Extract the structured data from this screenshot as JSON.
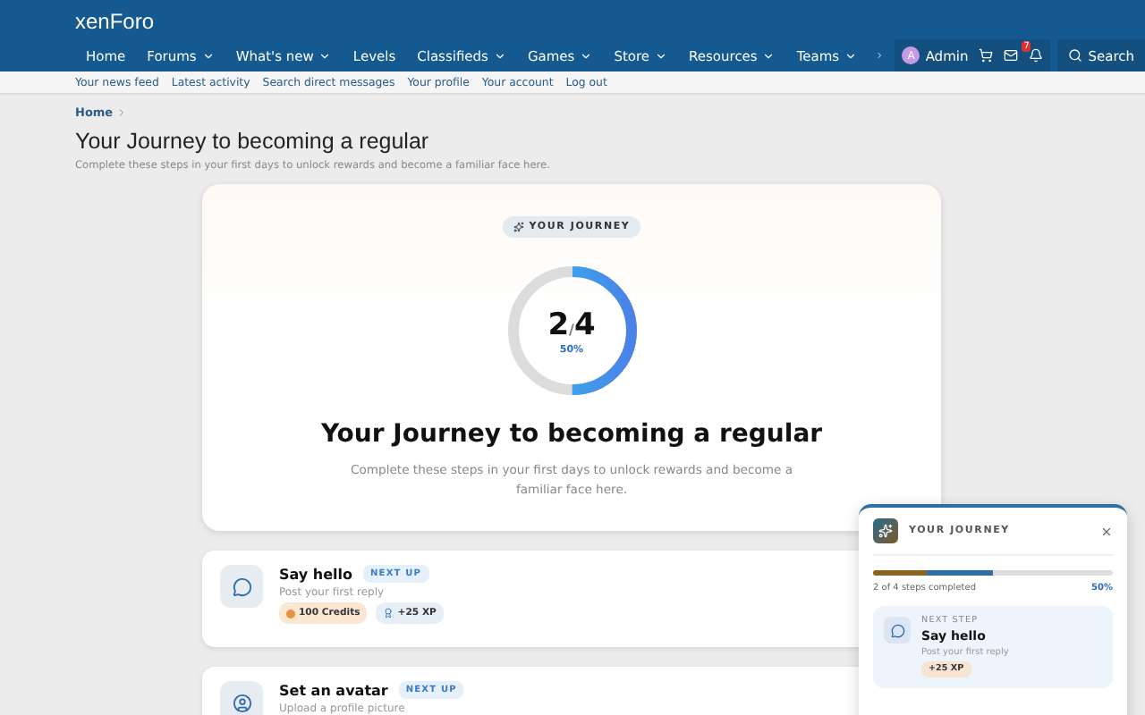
{
  "header": {
    "logo": "xenForo",
    "nav": [
      {
        "label": "Home",
        "dropdown": false,
        "selected": false
      },
      {
        "label": "Forums",
        "dropdown": true,
        "selected": false
      },
      {
        "label": "What's new",
        "dropdown": true,
        "selected": false
      },
      {
        "label": "Levels",
        "dropdown": false,
        "selected": false
      },
      {
        "label": "Classifieds",
        "dropdown": true,
        "selected": false
      },
      {
        "label": "Games",
        "dropdown": true,
        "selected": false
      },
      {
        "label": "Store",
        "dropdown": true,
        "selected": false
      },
      {
        "label": "Resources",
        "dropdown": true,
        "selected": false
      },
      {
        "label": "Teams",
        "dropdown": true,
        "selected": false
      }
    ],
    "user": {
      "avatar": "A",
      "name": "Admin"
    },
    "alert_badge": "7",
    "search": "Search"
  },
  "subnav": [
    "Your news feed",
    "Latest activity",
    "Search direct messages",
    "Your profile",
    "Your account",
    "Log out"
  ],
  "breadcrumb": "Home",
  "page_title": "Your Journey to becoming a regular",
  "page_description": "Complete these steps in your first days to unlock rewards and become a familiar face here.",
  "hero": {
    "badge": "YOUR JOURNEY",
    "count": "2",
    "separator": "/",
    "total": "4",
    "percent": "50%",
    "level": 0.5,
    "title": "Your Journey to becoming a regular",
    "description": "Complete these steps in your first days to unlock rewards and become a familiar face here."
  },
  "steps": [
    {
      "kind": "chat",
      "title": "Say hello",
      "tag": "NEXT UP",
      "description": "Post your first reply",
      "rewards": [
        {
          "kind": "credits",
          "label": "100 Credits"
        },
        {
          "kind": "xp",
          "label": "+25 XP"
        }
      ]
    },
    {
      "kind": "user",
      "title": "Set an avatar",
      "tag": "NEXT UP",
      "description": "Upload a profile picture"
    }
  ],
  "popup": {
    "title": "YOUR JOURNEY",
    "level": 0.5,
    "progress_text": "2 of 4 steps completed",
    "percent": "50%",
    "next_label": "NEXT STEP",
    "next_title": "Say hello",
    "next_description": "Post your first reply",
    "next_reward": "+25 XP"
  }
}
